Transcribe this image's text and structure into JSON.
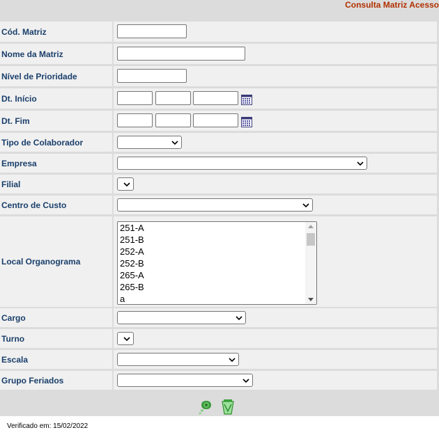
{
  "header": {
    "title": "Consulta Matriz Acesso"
  },
  "form": {
    "cod_matriz": {
      "label": "Cód. Matriz",
      "value": ""
    },
    "nome_matriz": {
      "label": "Nome da Matriz",
      "value": ""
    },
    "nivel_prioridade": {
      "label": "Nível de Prioridade",
      "value": ""
    },
    "dt_inicio": {
      "label": "Dt. Início",
      "day": "",
      "month": "",
      "year": "",
      "icon": "calendar-icon"
    },
    "dt_fim": {
      "label": "Dt. Fim",
      "day": "",
      "month": "",
      "year": "",
      "icon": "calendar-icon"
    },
    "tipo_colaborador": {
      "label": "Tipo de Colaborador",
      "selected": ""
    },
    "empresa": {
      "label": "Empresa",
      "selected": ""
    },
    "filial": {
      "label": "Filial",
      "selected": ""
    },
    "centro_custo": {
      "label": "Centro de Custo",
      "selected": ""
    },
    "local_organograma": {
      "label": "Local Organograma",
      "options": [
        "251-A",
        "251-B",
        "252-A",
        "252-B",
        "265-A",
        "265-B",
        "a"
      ]
    },
    "cargo": {
      "label": "Cargo",
      "selected": ""
    },
    "turno": {
      "label": "Turno",
      "selected": ""
    },
    "escala": {
      "label": "Escala",
      "selected": ""
    },
    "grupo_feriados": {
      "label": "Grupo Feriados",
      "selected": ""
    }
  },
  "actions": {
    "search_icon": "search-binoculars-icon",
    "clear_icon": "clear-recycle-icon"
  },
  "footer": {
    "verified": "Verificado em: 15/02/2022"
  },
  "colors": {
    "title": "#b03000",
    "label": "#1a3f6b",
    "panel": "#dcdcdc",
    "row": "#f0f0f0"
  }
}
